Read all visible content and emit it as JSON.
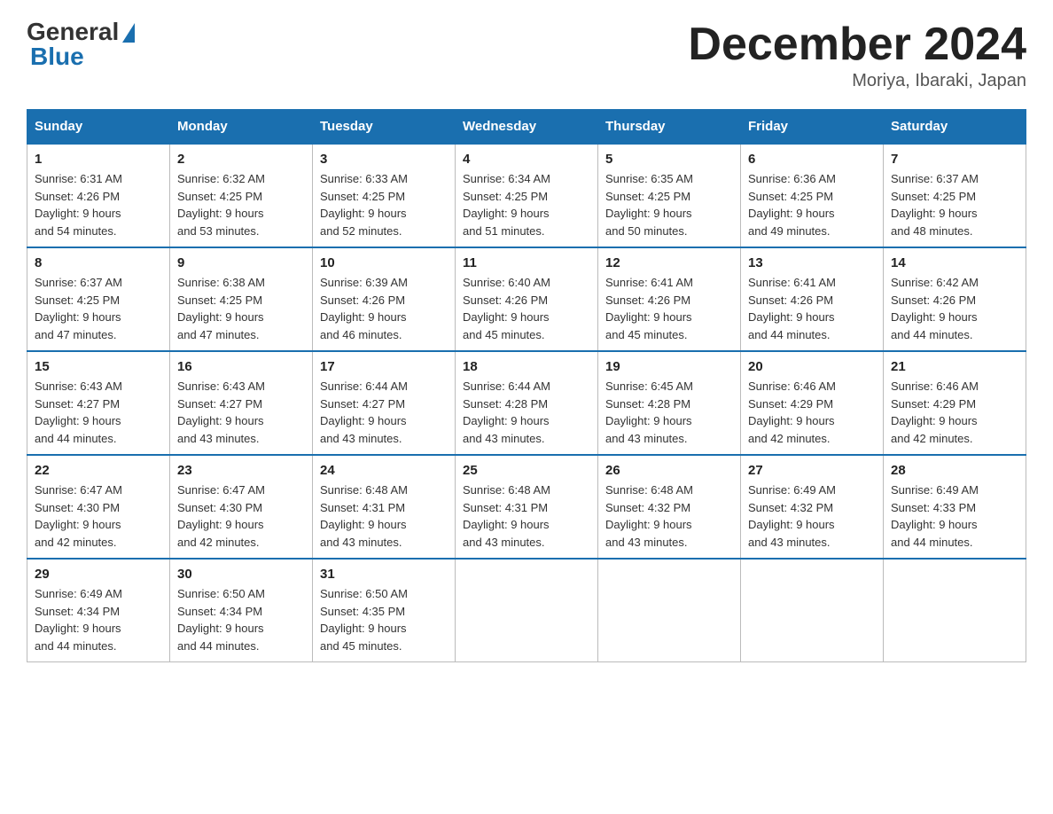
{
  "logo": {
    "general": "General",
    "blue": "Blue"
  },
  "header": {
    "month_title": "December 2024",
    "location": "Moriya, Ibaraki, Japan"
  },
  "days_of_week": [
    "Sunday",
    "Monday",
    "Tuesday",
    "Wednesday",
    "Thursday",
    "Friday",
    "Saturday"
  ],
  "weeks": [
    [
      {
        "day": "1",
        "sunrise": "6:31 AM",
        "sunset": "4:26 PM",
        "daylight": "9 hours and 54 minutes."
      },
      {
        "day": "2",
        "sunrise": "6:32 AM",
        "sunset": "4:25 PM",
        "daylight": "9 hours and 53 minutes."
      },
      {
        "day": "3",
        "sunrise": "6:33 AM",
        "sunset": "4:25 PM",
        "daylight": "9 hours and 52 minutes."
      },
      {
        "day": "4",
        "sunrise": "6:34 AM",
        "sunset": "4:25 PM",
        "daylight": "9 hours and 51 minutes."
      },
      {
        "day": "5",
        "sunrise": "6:35 AM",
        "sunset": "4:25 PM",
        "daylight": "9 hours and 50 minutes."
      },
      {
        "day": "6",
        "sunrise": "6:36 AM",
        "sunset": "4:25 PM",
        "daylight": "9 hours and 49 minutes."
      },
      {
        "day": "7",
        "sunrise": "6:37 AM",
        "sunset": "4:25 PM",
        "daylight": "9 hours and 48 minutes."
      }
    ],
    [
      {
        "day": "8",
        "sunrise": "6:37 AM",
        "sunset": "4:25 PM",
        "daylight": "9 hours and 47 minutes."
      },
      {
        "day": "9",
        "sunrise": "6:38 AM",
        "sunset": "4:25 PM",
        "daylight": "9 hours and 47 minutes."
      },
      {
        "day": "10",
        "sunrise": "6:39 AM",
        "sunset": "4:26 PM",
        "daylight": "9 hours and 46 minutes."
      },
      {
        "day": "11",
        "sunrise": "6:40 AM",
        "sunset": "4:26 PM",
        "daylight": "9 hours and 45 minutes."
      },
      {
        "day": "12",
        "sunrise": "6:41 AM",
        "sunset": "4:26 PM",
        "daylight": "9 hours and 45 minutes."
      },
      {
        "day": "13",
        "sunrise": "6:41 AM",
        "sunset": "4:26 PM",
        "daylight": "9 hours and 44 minutes."
      },
      {
        "day": "14",
        "sunrise": "6:42 AM",
        "sunset": "4:26 PM",
        "daylight": "9 hours and 44 minutes."
      }
    ],
    [
      {
        "day": "15",
        "sunrise": "6:43 AM",
        "sunset": "4:27 PM",
        "daylight": "9 hours and 44 minutes."
      },
      {
        "day": "16",
        "sunrise": "6:43 AM",
        "sunset": "4:27 PM",
        "daylight": "9 hours and 43 minutes."
      },
      {
        "day": "17",
        "sunrise": "6:44 AM",
        "sunset": "4:27 PM",
        "daylight": "9 hours and 43 minutes."
      },
      {
        "day": "18",
        "sunrise": "6:44 AM",
        "sunset": "4:28 PM",
        "daylight": "9 hours and 43 minutes."
      },
      {
        "day": "19",
        "sunrise": "6:45 AM",
        "sunset": "4:28 PM",
        "daylight": "9 hours and 43 minutes."
      },
      {
        "day": "20",
        "sunrise": "6:46 AM",
        "sunset": "4:29 PM",
        "daylight": "9 hours and 42 minutes."
      },
      {
        "day": "21",
        "sunrise": "6:46 AM",
        "sunset": "4:29 PM",
        "daylight": "9 hours and 42 minutes."
      }
    ],
    [
      {
        "day": "22",
        "sunrise": "6:47 AM",
        "sunset": "4:30 PM",
        "daylight": "9 hours and 42 minutes."
      },
      {
        "day": "23",
        "sunrise": "6:47 AM",
        "sunset": "4:30 PM",
        "daylight": "9 hours and 42 minutes."
      },
      {
        "day": "24",
        "sunrise": "6:48 AM",
        "sunset": "4:31 PM",
        "daylight": "9 hours and 43 minutes."
      },
      {
        "day": "25",
        "sunrise": "6:48 AM",
        "sunset": "4:31 PM",
        "daylight": "9 hours and 43 minutes."
      },
      {
        "day": "26",
        "sunrise": "6:48 AM",
        "sunset": "4:32 PM",
        "daylight": "9 hours and 43 minutes."
      },
      {
        "day": "27",
        "sunrise": "6:49 AM",
        "sunset": "4:32 PM",
        "daylight": "9 hours and 43 minutes."
      },
      {
        "day": "28",
        "sunrise": "6:49 AM",
        "sunset": "4:33 PM",
        "daylight": "9 hours and 44 minutes."
      }
    ],
    [
      {
        "day": "29",
        "sunrise": "6:49 AM",
        "sunset": "4:34 PM",
        "daylight": "9 hours and 44 minutes."
      },
      {
        "day": "30",
        "sunrise": "6:50 AM",
        "sunset": "4:34 PM",
        "daylight": "9 hours and 44 minutes."
      },
      {
        "day": "31",
        "sunrise": "6:50 AM",
        "sunset": "4:35 PM",
        "daylight": "9 hours and 45 minutes."
      },
      null,
      null,
      null,
      null
    ]
  ],
  "labels": {
    "sunrise": "Sunrise:",
    "sunset": "Sunset:",
    "daylight": "Daylight:"
  }
}
